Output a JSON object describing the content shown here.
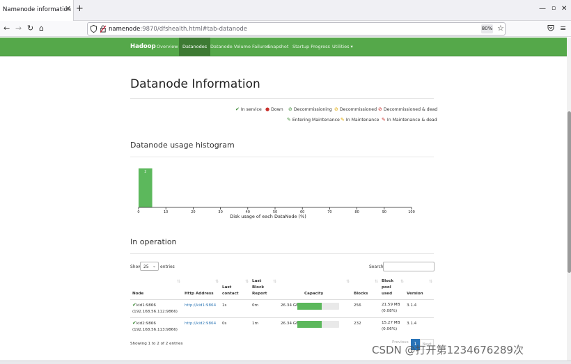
{
  "browser": {
    "tab_title": "Namenode information",
    "tab_close": "✕",
    "new_tab": "+",
    "url_host": "namenode",
    "url_rest": ":9870/dfshealth.html#tab-datanode",
    "zoom": "80%"
  },
  "nav": {
    "brand": "Hadoop",
    "items": [
      "Overview",
      "Datanodes",
      "Datanode Volume Failures",
      "Snapshot",
      "Startup Progress",
      "Utilities ▾"
    ]
  },
  "page": {
    "title": "Datanode Information",
    "legend": [
      {
        "symbol": "✔",
        "label": "In service",
        "color": "#3d8b37"
      },
      {
        "symbol": "●",
        "label": "Down",
        "color": "#c9302c"
      },
      {
        "symbol": "⊘",
        "label": "Decommissioning",
        "color": "#3d8b37"
      },
      {
        "symbol": "⊘",
        "label": "Decommissioned",
        "color": "#e0a800"
      },
      {
        "symbol": "⊘",
        "label": "Decommissioned & dead",
        "color": "#c9302c"
      },
      {
        "symbol": "✎",
        "label": "Entering Maintenance",
        "color": "#3d8b37"
      },
      {
        "symbol": "✎",
        "label": "In Maintenance",
        "color": "#e0a800"
      },
      {
        "symbol": "✎",
        "label": "In Maintenance & dead",
        "color": "#c9302c"
      }
    ],
    "histogram_heading": "Datanode usage histogram",
    "operation_heading": "In operation"
  },
  "chart_data": {
    "type": "bar",
    "title": "",
    "xlabel": "Disk usage of each DataNode (%)",
    "ylabel": "",
    "x_ticks": [
      0,
      10,
      20,
      30,
      40,
      50,
      60,
      70,
      80,
      90,
      100
    ],
    "xlim": [
      0,
      100
    ],
    "bars": [
      {
        "x_start": 0,
        "x_end": 5,
        "value": 2
      }
    ],
    "bar_color": "#5cb85c",
    "grid": false
  },
  "table": {
    "show_label": "Show",
    "page_size": "25",
    "entries_label": "entries",
    "search_label": "Search:",
    "headers": {
      "node": "Node",
      "http": "Http Address",
      "last_contact": [
        "Last",
        "contact"
      ],
      "last_block": [
        "Last",
        "Block",
        "Report"
      ],
      "capacity": "Capacity",
      "blocks": "Blocks",
      "pool": [
        "Block",
        "pool",
        "used"
      ],
      "version": "Version"
    },
    "rows": [
      {
        "node": "kid1:9866",
        "node_ip": "(192.168.56.112:9866)",
        "http": "http://kid1:9864",
        "last_contact": "1s",
        "last_block": "0m",
        "capacity": "26.34 GB",
        "used_fraction": 0.58,
        "blocks": "256",
        "pool": "21.59 MB",
        "pool_pct": "(0.08%)",
        "version": "3.1.4"
      },
      {
        "node": "kid2:9866",
        "node_ip": "(192.168.56.113:9866)",
        "http": "http://kid2:9864",
        "last_contact": "0s",
        "last_block": "1m",
        "capacity": "26.34 GB",
        "used_fraction": 0.58,
        "blocks": "232",
        "pool": "15.27 MB",
        "pool_pct": "(0.06%)",
        "version": "3.1.4"
      }
    ],
    "footer": "Showing 1 to 2 of 2 entries",
    "prev": "Previous",
    "page": "1",
    "next": "Next"
  },
  "watermark": "CSDN @打开第1234676289次"
}
